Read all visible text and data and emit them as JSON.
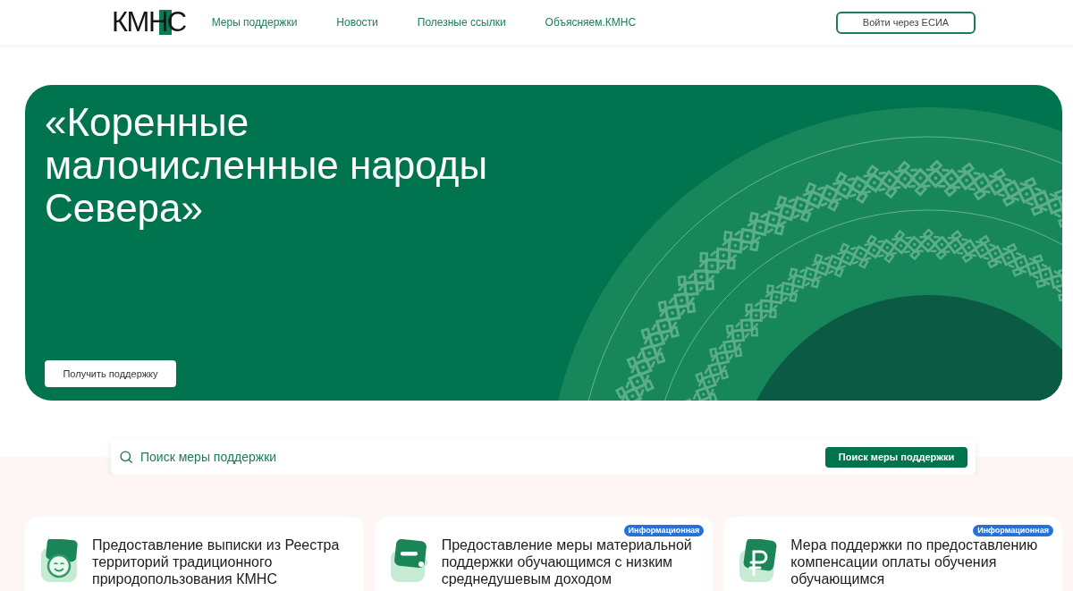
{
  "header": {
    "logo": "КМНС",
    "nav": [
      "Меры поддержки",
      "Новости",
      "Полезные ссылки",
      "Объясняем.КМНС"
    ],
    "login_button": "Войти через ЕСИА"
  },
  "hero": {
    "title": "«Коренные малочисленные народы Севера»",
    "button": "Получить поддержку"
  },
  "search": {
    "placeholder": "Поиск меры поддержки",
    "button": "Поиск меры поддержки"
  },
  "cards": [
    {
      "title": "Предоставление выписки из Реестра территорий традиционного природопользования КМНС"
    },
    {
      "title": "Предоставление меры материальной поддержки обучающимся с низким среднедушевым доходом",
      "badge": "Информационная"
    },
    {
      "title": "Мера поддержки по предоставлению компенсации оплаты обучения обучающимся",
      "badge": "Информационная"
    }
  ]
}
